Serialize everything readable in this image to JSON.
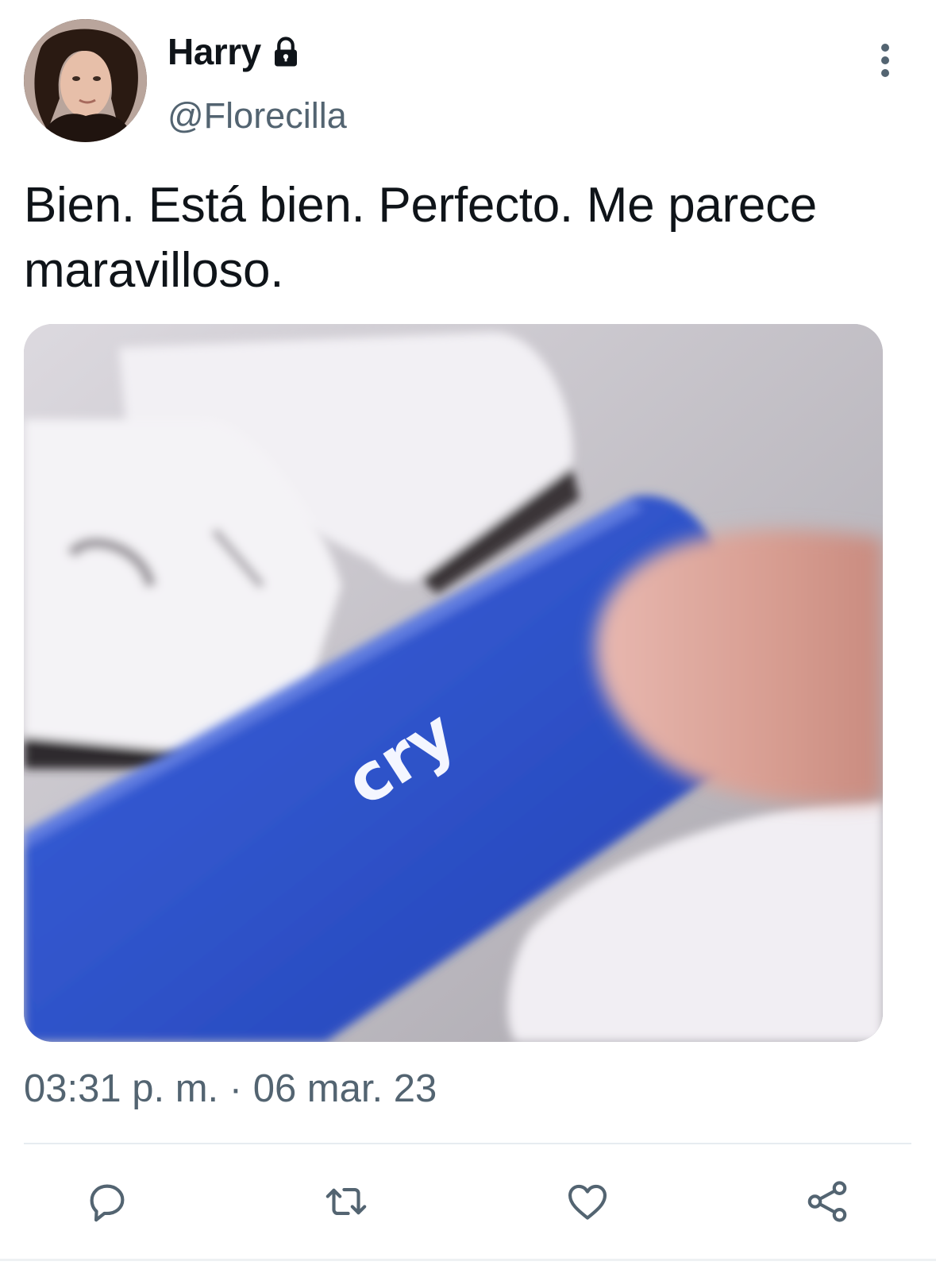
{
  "author": {
    "display_name": "Harry",
    "handle": "@Florecilla",
    "protected_icon": "lock-icon"
  },
  "tweet": {
    "text": "Bien. Está bien. Perfecto. Me parece maravilloso.",
    "timestamp": "03:31 p. m. · 06 mar. 23"
  },
  "media": {
    "key_label": "cry",
    "key_color": "#2f55cf"
  },
  "actions": {
    "reply_icon": "reply-icon",
    "retweet_icon": "retweet-icon",
    "like_icon": "heart-icon",
    "share_icon": "share-icon"
  },
  "colors": {
    "text_primary": "#0f1419",
    "text_secondary": "#536471",
    "divider": "#e6ecf0"
  }
}
